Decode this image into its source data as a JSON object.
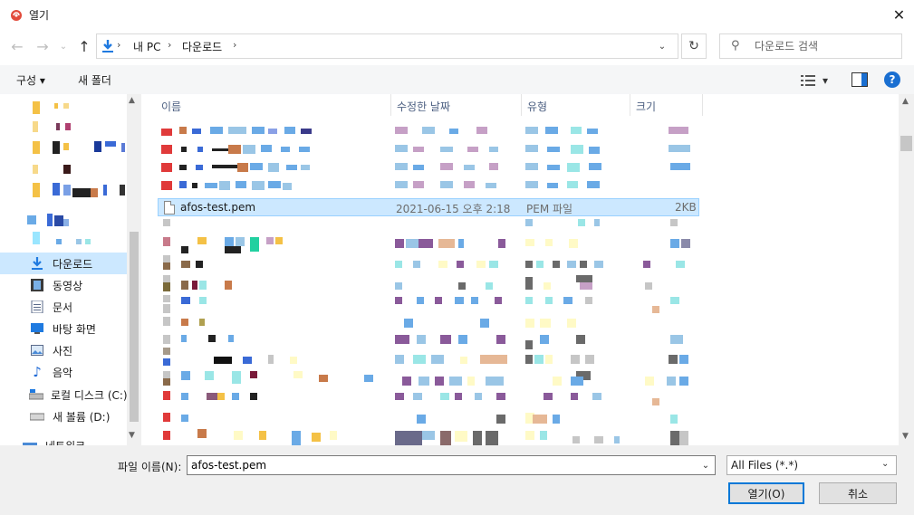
{
  "window": {
    "title": "열기",
    "close_glyph": "✕"
  },
  "nav": {
    "back_glyph": "←",
    "forward_glyph": "→",
    "recent_glyph": "⌄",
    "up_glyph": "↑"
  },
  "address": {
    "segments": [
      "내 PC",
      "다운로드"
    ],
    "separator": "›",
    "dropdown_glyph": "⌄"
  },
  "refresh_glyph": "↻",
  "search": {
    "placeholder": "다운로드 검색",
    "icon_glyph": "⚲"
  },
  "toolbar": {
    "organize_label": "구성 ▾",
    "new_folder_label": "새 폴더",
    "help_label": "?",
    "view_dropdown_glyph": "▾"
  },
  "sidebar": {
    "items": [
      {
        "label": "다운로드",
        "icon": "download-arrow-icon"
      },
      {
        "label": "동영상",
        "icon": "film-icon"
      },
      {
        "label": "문서",
        "icon": "document-icon"
      },
      {
        "label": "바탕 화면",
        "icon": "desktop-icon"
      },
      {
        "label": "사진",
        "icon": "picture-icon"
      },
      {
        "label": "음악",
        "icon": "music-note-icon"
      },
      {
        "label": "로컬 디스크 (C:)",
        "icon": "drive-icon"
      },
      {
        "label": "새 볼륨 (D:)",
        "icon": "drive-icon"
      },
      {
        "label": "네트워크",
        "icon": "network-icon"
      }
    ],
    "selected_index": 0
  },
  "columns": {
    "name": "이름",
    "date": "수정한 날짜",
    "type": "유형",
    "size": "크기",
    "sort_glyph": "⌃"
  },
  "selected_file": {
    "name": "afos-test.pem",
    "date": "2021-06-15 오후 2:18",
    "type": "PEM 파일",
    "size": "2KB"
  },
  "bottom": {
    "filename_label": "파일 이름(N):",
    "filename_value": "afos-test.pem",
    "filetype_value": "All Files (*.*)",
    "open_label": "열기(O)",
    "cancel_label": "취소",
    "dropdown_glyph": "⌄"
  },
  "scroll": {
    "up_glyph": "▲",
    "down_glyph": "▼"
  },
  "colors": {
    "accent": "#0078d7",
    "selection": "#cce8ff",
    "folder": "#f4c146",
    "help": "#1a6fd1"
  }
}
